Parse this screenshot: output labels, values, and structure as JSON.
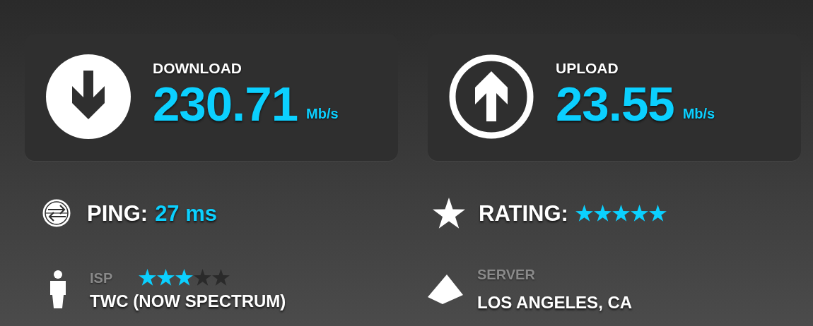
{
  "results": [
    {
      "kind": "download",
      "label": "DOWNLOAD",
      "value": "230.71",
      "unit": "Mb/s"
    },
    {
      "kind": "upload",
      "label": "UPLOAD",
      "value": "23.55",
      "unit": "Mb/s"
    }
  ],
  "ping": {
    "label": "PING:",
    "value": "27 ms"
  },
  "rating": {
    "label": "RATING:",
    "stars": 5
  },
  "isp": {
    "label": "ISP",
    "stars": 3,
    "name": "TWC (NOW SPECTRUM)"
  },
  "server": {
    "label": "SERVER",
    "name": "LOS ANGELES, CA"
  }
}
